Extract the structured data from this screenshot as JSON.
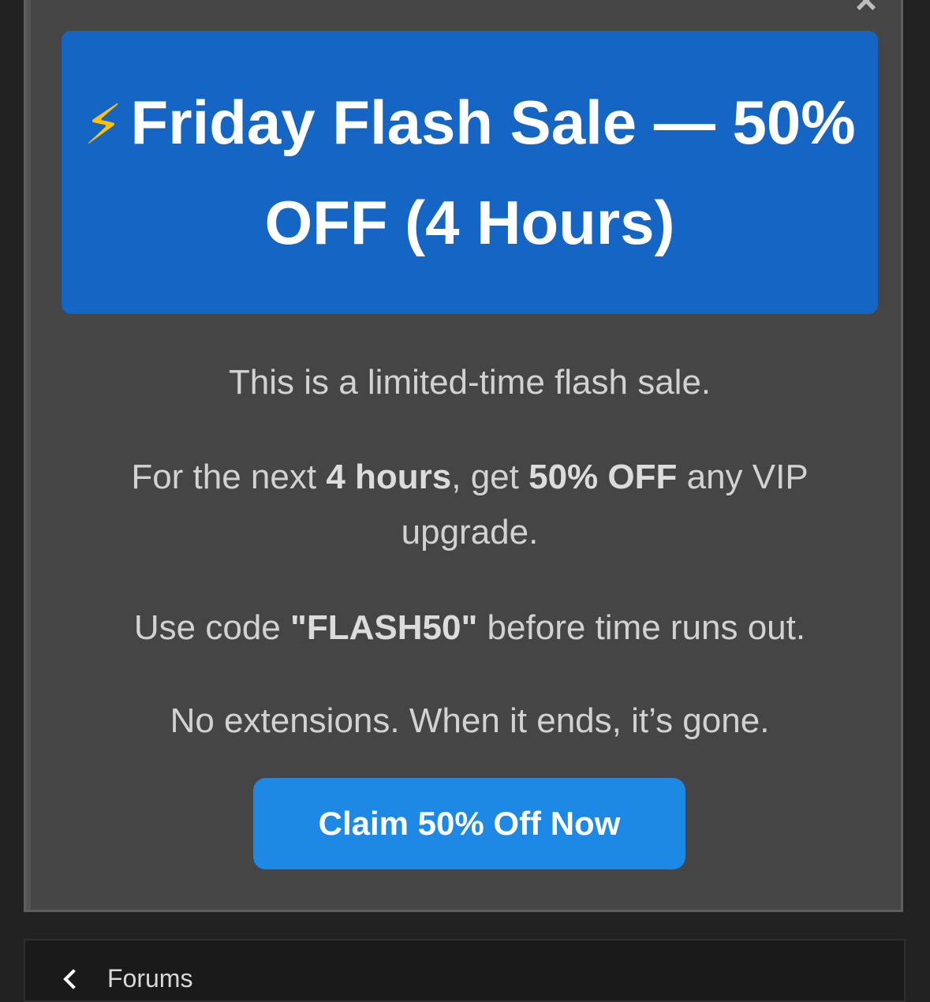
{
  "modal": {
    "close_label": "×",
    "banner": {
      "icon": "⚡",
      "title": "Friday Flash Sale — 50% OFF (4 Hours)",
      "background": "#1565c5"
    },
    "paragraphs": {
      "p1": "This is a limited-time flash sale.",
      "p2_prefix": "For the next ",
      "p2_hours": "4 hours",
      "p2_middle": ", get ",
      "p2_discount": "50% OFF",
      "p2_suffix": " any VIP upgrade.",
      "p3_prefix": "Use code ",
      "p3_code": "\"FLASH50\"",
      "p3_suffix": " before time runs out.",
      "p4": "No extensions. When it ends, it’s gone."
    },
    "cta_label": "Claim 50% Off Now",
    "cta_color": "#1e88e5"
  },
  "nav": {
    "back_icon": "chevron-left-icon",
    "back_label": "Forums"
  }
}
